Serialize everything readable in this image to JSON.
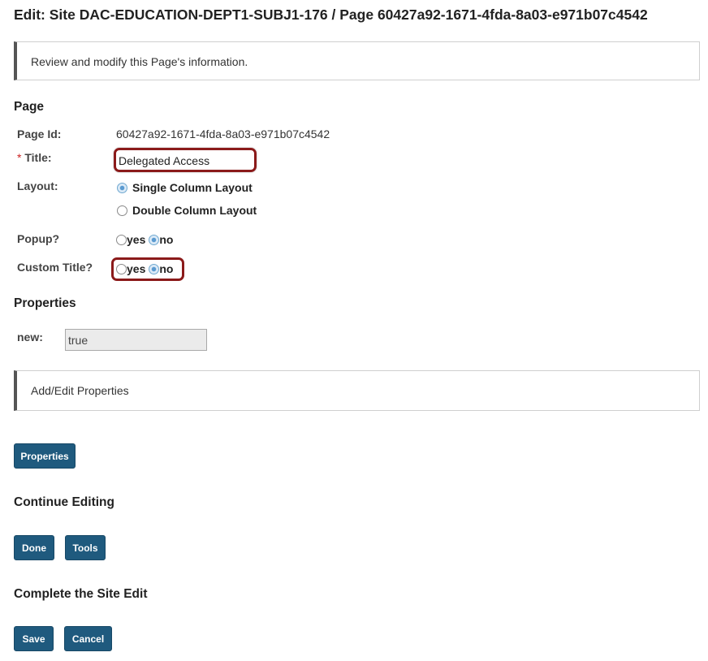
{
  "page_title": "Edit: Site DAC-EDUCATION-DEPT1-SUBJ1-176 / Page 60427a92-1671-4fda-8a03-e971b07c4542",
  "instructions": "Review and modify this Page's information.",
  "page_section": {
    "heading": "Page",
    "page_id_label": "Page Id:",
    "page_id_value": "60427a92-1671-4fda-8a03-e971b07c4542",
    "title_required_marker": "*",
    "title_label": "Title:",
    "title_value": "Delegated Access",
    "layout_label": "Layout:",
    "layout_options": [
      "Single Column Layout",
      "Double Column Layout"
    ],
    "layout_selected": "Single Column Layout",
    "popup_label": "Popup?",
    "popup_yes": "yes",
    "popup_no": "no",
    "popup_selected": "no",
    "custom_title_label": "Custom Title?",
    "custom_title_yes": "yes",
    "custom_title_no": "no",
    "custom_title_selected": "no"
  },
  "properties_section": {
    "heading": "Properties",
    "new_label": "new:",
    "new_value": "true",
    "panel_text": "Add/Edit Properties",
    "properties_button": "Properties"
  },
  "continue_section": {
    "heading": "Continue Editing",
    "done_button": "Done",
    "tools_button": "Tools"
  },
  "complete_section": {
    "heading": "Complete the Site Edit",
    "save_button": "Save",
    "cancel_button": "Cancel"
  },
  "colors": {
    "button_bg": "#1f5a7e",
    "highlight_border": "#8b1a1a",
    "panel_left_border": "#555555"
  }
}
